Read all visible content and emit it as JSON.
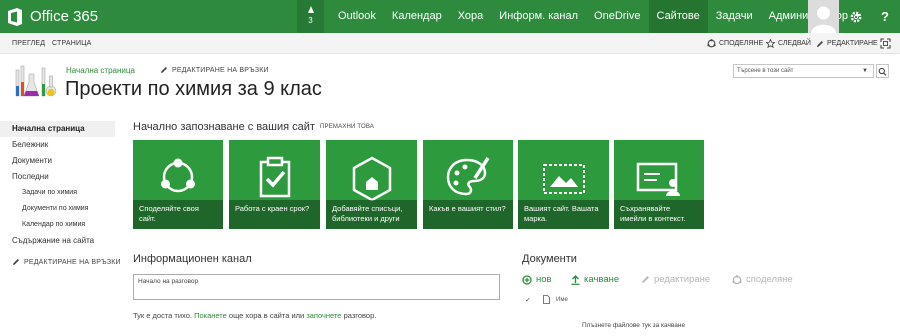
{
  "suitebar": {
    "brand": "Office 365",
    "notifications_count": "3",
    "nav": [
      "Outlook",
      "Календар",
      "Хора",
      "Информ. канал",
      "OneDrive",
      "Сайтове",
      "Задачи",
      "Администратор"
    ],
    "active_nav": "Сайтове",
    "help_label": "?"
  },
  "ribbon": {
    "tabs": [
      "ПРЕГЛЕД",
      "СТРАНИЦА"
    ],
    "actions": [
      "СПОДЕЛЯНЕ",
      "СЛЕДВАЙ",
      "РЕДАКТИРАНЕ"
    ]
  },
  "header": {
    "breadcrumb_home": "Начална страница",
    "edit_links": "РЕДАКТИРАНЕ НА ВРЪЗКИ",
    "site_title": "Проекти по химия за 9 клас",
    "search_placeholder": "Търсене в този сайт"
  },
  "leftnav": {
    "items": [
      {
        "label": "Начална страница",
        "selected": true,
        "sub": false
      },
      {
        "label": "Бележник",
        "selected": false,
        "sub": false
      },
      {
        "label": "Документи",
        "selected": false,
        "sub": false
      },
      {
        "label": "Последни",
        "selected": false,
        "sub": false
      },
      {
        "label": "Задачи по химия",
        "selected": false,
        "sub": true
      },
      {
        "label": "Документи по химия",
        "selected": false,
        "sub": true
      },
      {
        "label": "Календар по химия",
        "selected": false,
        "sub": true
      },
      {
        "label": "Съдържание на сайта",
        "selected": false,
        "sub": false
      }
    ],
    "edit_links": "РЕДАКТИРАНЕ НА ВРЪЗКИ"
  },
  "getting_started": {
    "title": "Начално запознаване с вашия сайт",
    "remove": "ПРЕМАХНИ ТОВА",
    "tiles": [
      {
        "caption": "Споделяйте своя сайт.",
        "icon": "share-icon"
      },
      {
        "caption": "Работа с краен срок?",
        "icon": "clipboard-check-icon"
      },
      {
        "caption": "Добавяйте списъци, библиотеки и други",
        "icon": "add-app-icon"
      },
      {
        "caption": "Какъв е вашият стил?",
        "icon": "palette-icon"
      },
      {
        "caption": "Вашият сайт. Вашата марка.",
        "icon": "picture-icon"
      },
      {
        "caption": "Съхранявайте имейли в контекст.",
        "icon": "mailbox-icon"
      }
    ],
    "tile_color": "#2e9a3e"
  },
  "newsfeed": {
    "title": "Информационен канал",
    "placeholder": "Начало на разговор",
    "quiet_prefix": "Тук е доста тихо. ",
    "quiet_link1": "Поканете",
    "quiet_middle": " още хора в сайта или ",
    "quiet_link2": "започнете",
    "quiet_suffix": " разговор."
  },
  "documents": {
    "title": "Документи",
    "cmd_new": "нов",
    "cmd_upload": "качване",
    "cmd_edit": "редактиране",
    "cmd_share": "споделяне",
    "col_check": "✓",
    "col_name": "Име",
    "drop_hint": "Плъзнете файлове тук за качване"
  },
  "colors": {
    "suitebar": "#2e8b3e",
    "accent": "#2e8b3e",
    "tile": "#2e9a3e"
  }
}
